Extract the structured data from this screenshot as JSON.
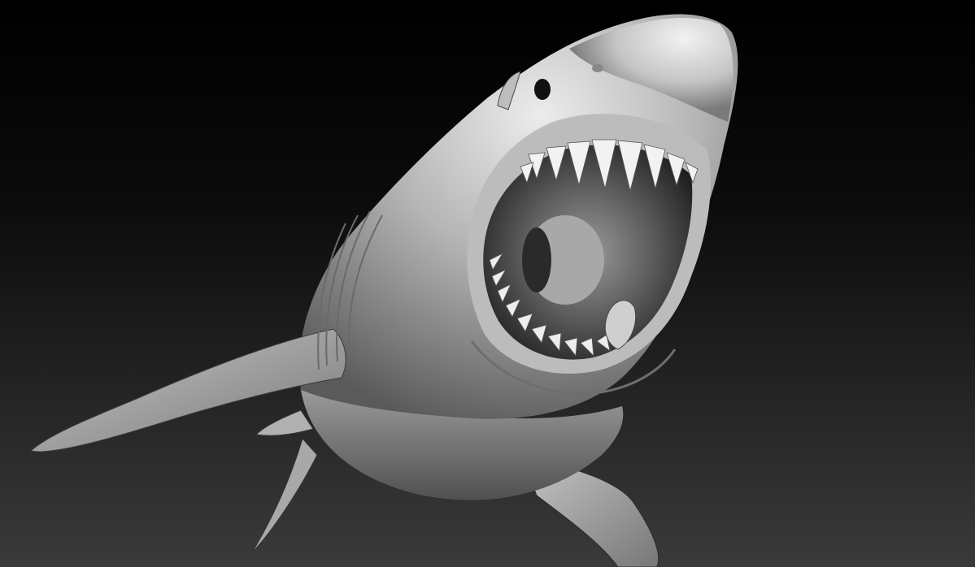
{
  "scene": {
    "subject": "great-white-shark-sculpt",
    "render_style": "grayscale clay matcap",
    "background_gradient": [
      "#000000",
      "#0b0b0b",
      "#3a3a3a"
    ],
    "body_tones": {
      "highlight": "#e8e8e8",
      "mid": "#a9a9a9",
      "shadow": "#4a4a4a",
      "mouth_interior": "#2a2a2a",
      "teeth": "#f2f2f2"
    }
  }
}
